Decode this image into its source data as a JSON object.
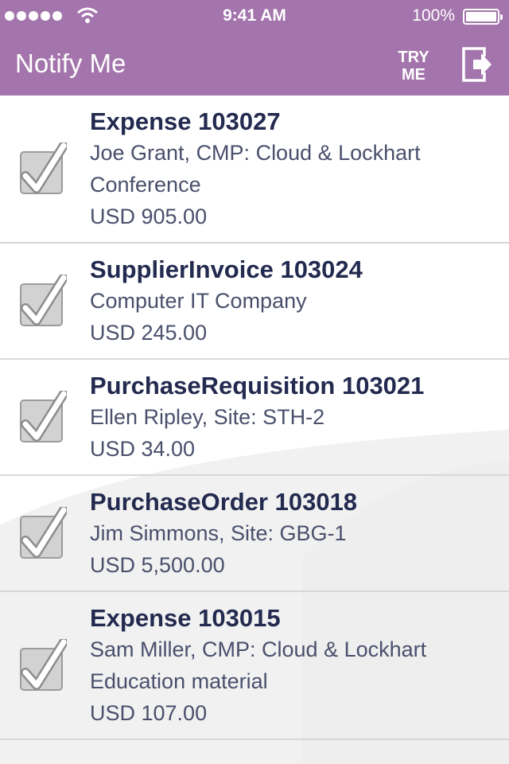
{
  "status_bar": {
    "time": "9:41 AM",
    "battery": "100%",
    "signal_icon": "signal-dots-icon",
    "wifi_icon": "wifi-icon",
    "battery_icon": "battery-icon"
  },
  "header": {
    "title": "Notify Me",
    "try_me_line1": "TRY",
    "try_me_line2": "ME",
    "logout_icon": "logout-icon",
    "background_color": "#a475ac"
  },
  "items": [
    {
      "title": "Expense 103027",
      "lines": [
        "Joe Grant, CMP: Cloud & Lockhart",
        "Conference",
        "USD 905.00"
      ]
    },
    {
      "title": "SupplierInvoice 103024",
      "lines": [
        "Computer IT Company",
        "USD 245.00"
      ]
    },
    {
      "title": "PurchaseRequisition 103021",
      "lines": [
        "Ellen Ripley, Site: STH-2",
        "USD 34.00"
      ]
    },
    {
      "title": "PurchaseOrder 103018",
      "lines": [
        "Jim Simmons, Site: GBG-1",
        "USD 5,500.00"
      ]
    },
    {
      "title": "Expense 103015",
      "lines": [
        "Sam Miller, CMP: Cloud & Lockhart",
        "Education material",
        "USD 107.00"
      ]
    }
  ],
  "colors": {
    "title_text": "#232a4f",
    "detail_text": "#4a4f6c",
    "divider": "#d7d7d7",
    "checkbox_fill": "#d2d2d2"
  }
}
